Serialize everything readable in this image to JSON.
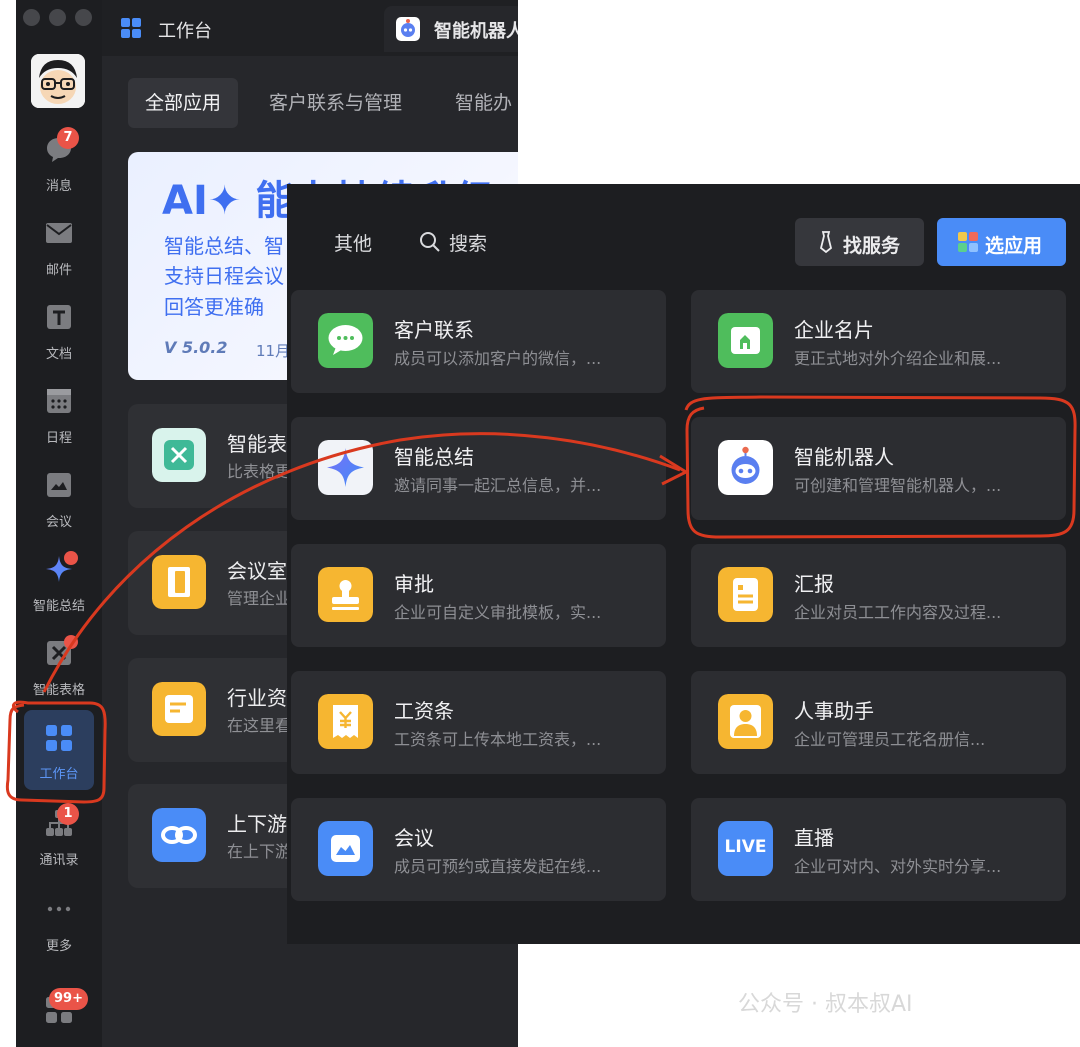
{
  "topbar": {
    "workbench_tab": "工作台",
    "robot_tab": "智能机器人"
  },
  "sidebar": {
    "items": [
      {
        "label": "消息",
        "badge": "7"
      },
      {
        "label": "邮件"
      },
      {
        "label": "文档"
      },
      {
        "label": "日程"
      },
      {
        "label": "会议"
      },
      {
        "label": "智能总结"
      },
      {
        "label": "智能表格"
      },
      {
        "label": "工作台"
      },
      {
        "label": "通讯录",
        "badge": "1"
      },
      {
        "label": "更多"
      }
    ],
    "bottom_badge": "99+"
  },
  "categories": [
    "全部应用",
    "客户联系与管理",
    "智能办"
  ],
  "banner": {
    "title": "AI✦ 能力持续升级",
    "lines": [
      "智能总结、智",
      "支持日程会议",
      "回答更准确"
    ],
    "version": "V 5.0.2",
    "date": "11月"
  },
  "back_cards": [
    {
      "title": "智能表",
      "desc": "比表格更"
    },
    {
      "title": "会议室",
      "desc": "管理企业"
    },
    {
      "title": "行业资",
      "desc": "在这里看"
    },
    {
      "title": "上下游",
      "desc": "在上下游"
    }
  ],
  "popup": {
    "others": "其他",
    "search": "搜索",
    "find_service": "找服务",
    "choose_app": "选应用",
    "apps": [
      {
        "title": "客户联系",
        "desc": "成员可以添加客户的微信，..."
      },
      {
        "title": "企业名片",
        "desc": "更正式地对外介绍企业和展..."
      },
      {
        "title": "智能总结",
        "desc": "邀请同事一起汇总信息，并..."
      },
      {
        "title": "智能机器人",
        "desc": "可创建和管理智能机器人，..."
      },
      {
        "title": "审批",
        "desc": "企业可自定义审批模板，实..."
      },
      {
        "title": "汇报",
        "desc": "企业对员工工作内容及过程..."
      },
      {
        "title": "工资条",
        "desc": "工资条可上传本地工资表，..."
      },
      {
        "title": "人事助手",
        "desc": "企业可管理员工花名册信..."
      },
      {
        "title": "会议",
        "desc": "成员可预约或直接发起在线..."
      },
      {
        "title": "直播",
        "desc": "企业可对内、对外实时分享..."
      }
    ],
    "live_text": "LIVE"
  },
  "watermark": "公众号 · 叔本叔AI",
  "colors": {
    "accent": "#4a8cf7",
    "badge": "#ea5448",
    "annotation": "#d9391f"
  }
}
